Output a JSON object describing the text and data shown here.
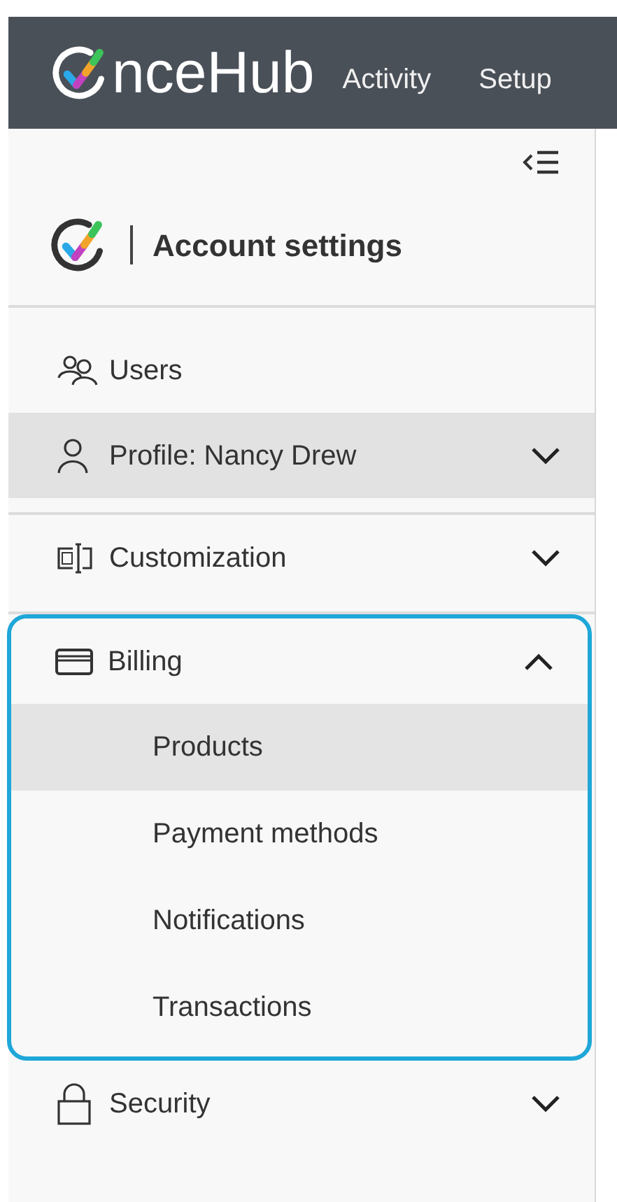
{
  "header": {
    "logo_text": "nceHub",
    "nav": [
      {
        "label": "Activity",
        "selected": false
      },
      {
        "label": "Setup",
        "selected": false
      }
    ]
  },
  "sidebar": {
    "title": "Account settings",
    "items": [
      {
        "label": "Users",
        "selected": false
      },
      {
        "label": "Profile: Nancy Drew",
        "selected": true,
        "expanded": false,
        "divider_after": true
      },
      {
        "label": "Customization",
        "selected": false,
        "expanded": false
      },
      {
        "label": "Billing",
        "selected": false,
        "expanded": true,
        "focused": true,
        "children": [
          {
            "label": "Products",
            "selected": true
          },
          {
            "label": "Payment methods",
            "selected": false
          },
          {
            "label": "Notifications",
            "selected": false
          },
          {
            "label": "Transactions",
            "selected": false
          }
        ]
      },
      {
        "label": "Security",
        "selected": false,
        "expanded": false
      }
    ]
  }
}
